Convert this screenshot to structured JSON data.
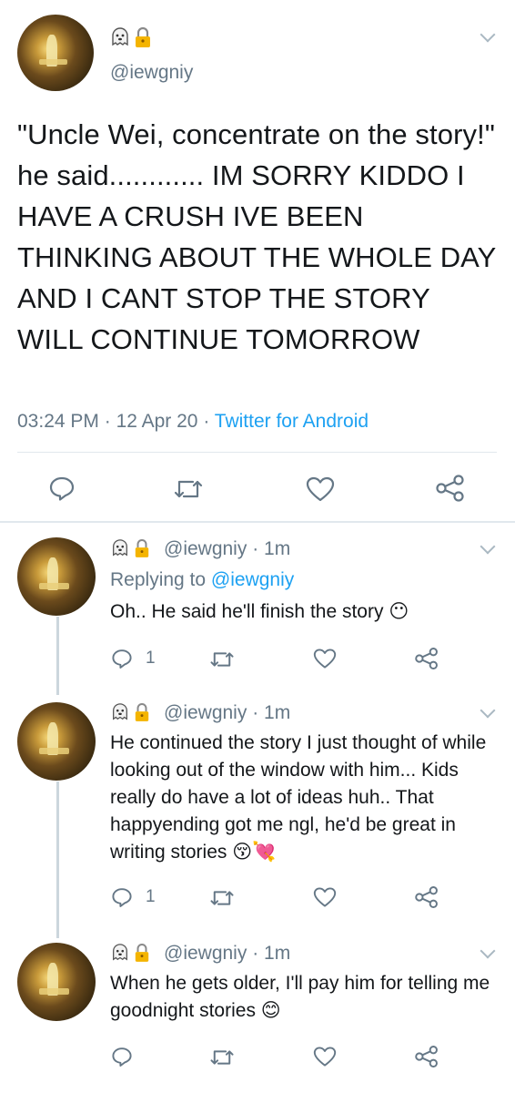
{
  "main_tweet": {
    "handle": "@iewgniy",
    "badge_icons": [
      "ghost-icon",
      "lock-icon"
    ],
    "text": "\"Uncle Wei, concentrate on the story!\" he said............ IM SORRY KIDDO I HAVE A CRUSH IVE BEEN THINKING ABOUT THE WHOLE DAY AND I CANT STOP THE STORY WILL CONTINUE TOMORROW",
    "time": "03:24 PM",
    "date": "12 Apr 20",
    "source": "Twitter for Android",
    "dot": "·"
  },
  "replies": [
    {
      "handle": "@iewgniy",
      "age": "1m",
      "replying_prefix": "Replying to",
      "replying_handle": "@iewgniy",
      "text": "Oh.. He said he'll finish the story",
      "emoji": "😶",
      "reply_count": "1"
    },
    {
      "handle": "@iewgniy",
      "age": "1m",
      "text": "He continued the story I just thought of while looking out of the window with him... Kids really do have a lot of ideas huh.. That happyending got me ngl, he'd be great in writing stories",
      "emoji": "😚💘",
      "reply_count": "1"
    },
    {
      "handle": "@iewgniy",
      "age": "1m",
      "text": "When he gets older, I'll pay him for telling me goodnight stories",
      "emoji": "😊"
    }
  ],
  "colors": {
    "link": "#1da1f2",
    "muted": "#657786",
    "divider": "#e1e8ed"
  }
}
